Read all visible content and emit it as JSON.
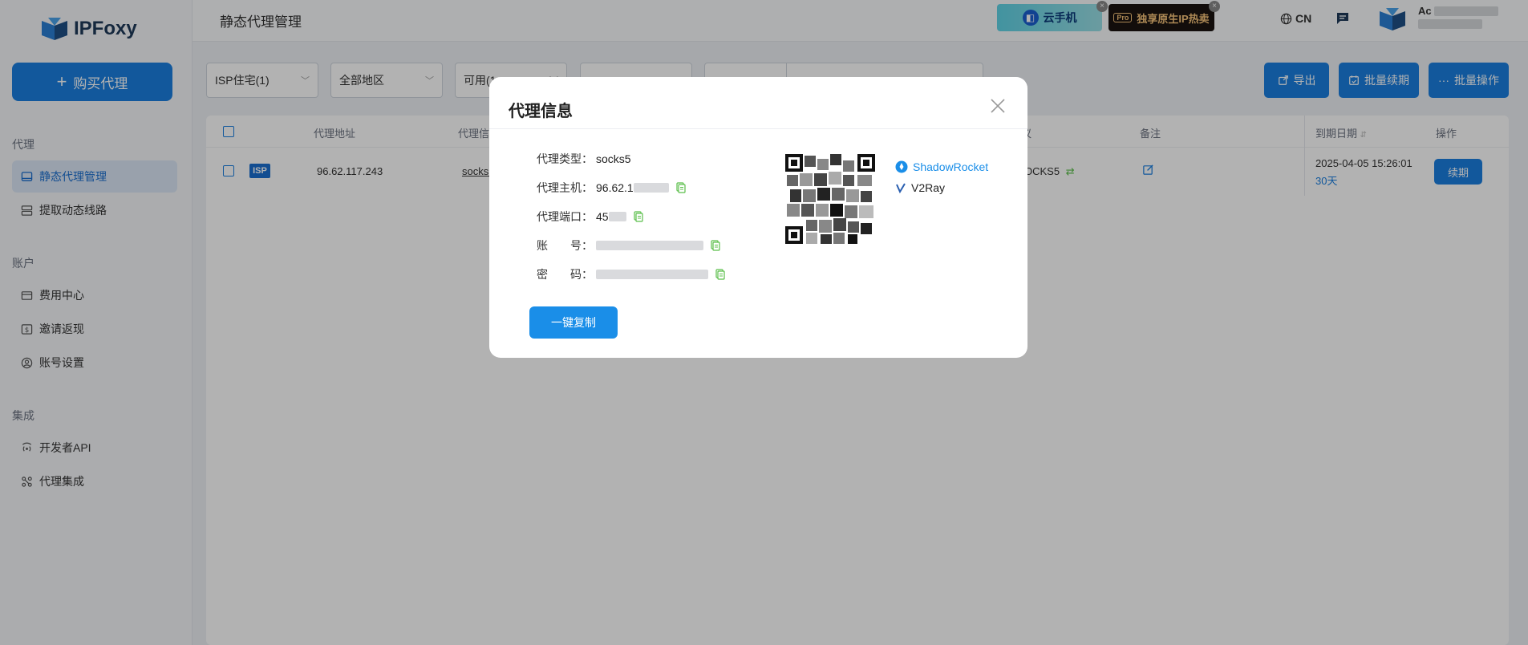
{
  "sidebar": {
    "logo_text": "IPFoxy",
    "buy_button": "购买代理",
    "sections": [
      {
        "title": "代理",
        "items": [
          {
            "label": "静态代理管理",
            "active": true
          },
          {
            "label": "提取动态线路"
          }
        ]
      },
      {
        "title": "账户",
        "items": [
          {
            "label": "费用中心"
          },
          {
            "label": "邀请返现"
          },
          {
            "label": "账号设置"
          }
        ]
      },
      {
        "title": "集成",
        "items": [
          {
            "label": "开发者API"
          },
          {
            "label": "代理集成"
          }
        ]
      }
    ]
  },
  "header": {
    "title": "静态代理管理",
    "promo_cloud_phone": "云手机",
    "promo_pro_tag": "Pro",
    "promo_native_ip": "独享原生IP热卖",
    "lang": "CN",
    "user_name": "Ac"
  },
  "filters": {
    "type": "ISP住宅(1)",
    "region": "全部地区",
    "status": "可用(1"
  },
  "actions": {
    "export": "导出",
    "batch_renew": "批量续期",
    "batch_ops": "批量操作"
  },
  "table": {
    "headers": {
      "address": "代理地址",
      "info": "代理信",
      "protocol": "议",
      "note": "备注",
      "expiry": "到期日期",
      "ops": "操作"
    },
    "row": {
      "badge": "ISP",
      "address": "96.62.117.243",
      "info": "socks!",
      "protocol": "OCKS5",
      "expiry": "2025-04-05 15:26:01",
      "days_left": "30天",
      "renew": "续期"
    }
  },
  "modal": {
    "title": "代理信息",
    "rows": {
      "type_label": "代理类型：",
      "type_value": "socks5",
      "host_label": "代理主机：",
      "host_value": "96.62.1",
      "port_label": "代理端口：",
      "port_value": "45",
      "account_label": "账　　号：",
      "password_label": "密　　码："
    },
    "apps": [
      "ShadowRocket",
      "V2Ray"
    ],
    "copy_all": "一键复制"
  },
  "colors": {
    "primary": "#1a7fe0",
    "link": "#1a8ee8",
    "copy_icon": "#5bbf4a"
  }
}
